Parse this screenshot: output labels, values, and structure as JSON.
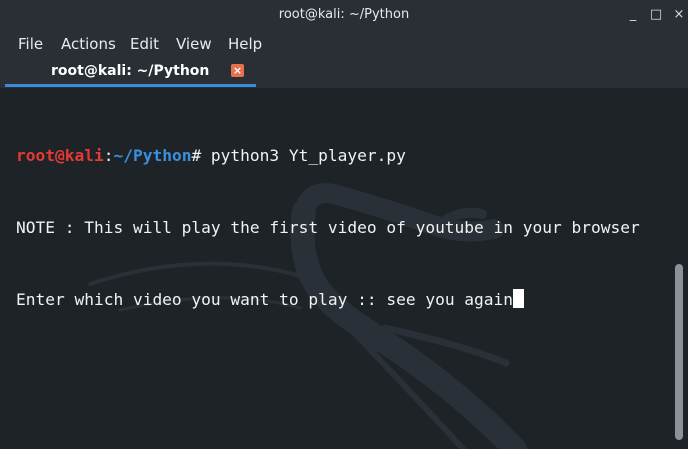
{
  "window": {
    "title": "root@kali: ~/Python",
    "controls": {
      "minimize": "_",
      "maximize": "□",
      "close": "×"
    }
  },
  "menubar": {
    "items": [
      "File",
      "Actions",
      "Edit",
      "View",
      "Help"
    ]
  },
  "tabs": [
    {
      "label": "root@kali: ~/Python",
      "close": "×",
      "active": true
    }
  ],
  "terminal": {
    "prompt": {
      "user_host": "root@kali",
      "separator": ":",
      "path": "~/Python",
      "symbol": "#"
    },
    "command": " python3 Yt_player.py",
    "output_lines": [
      "NOTE : This will play the first video of youtube in your browser"
    ],
    "input_line": {
      "prompt": "Enter which video you want to play :: ",
      "value": "see you again"
    },
    "scrollbar": {
      "position_fraction": 0.5
    }
  },
  "colors": {
    "background": "#1e2328",
    "chrome": "#2a2f36",
    "user_host": "#e53935",
    "path": "#3a8fe0",
    "tab_underline": "#3a8cd6",
    "tab_close": "#e8704f",
    "text": "#f2f2f2"
  },
  "icons": {
    "watermark": "kali-dragon-icon",
    "tab_close": "close-icon"
  }
}
